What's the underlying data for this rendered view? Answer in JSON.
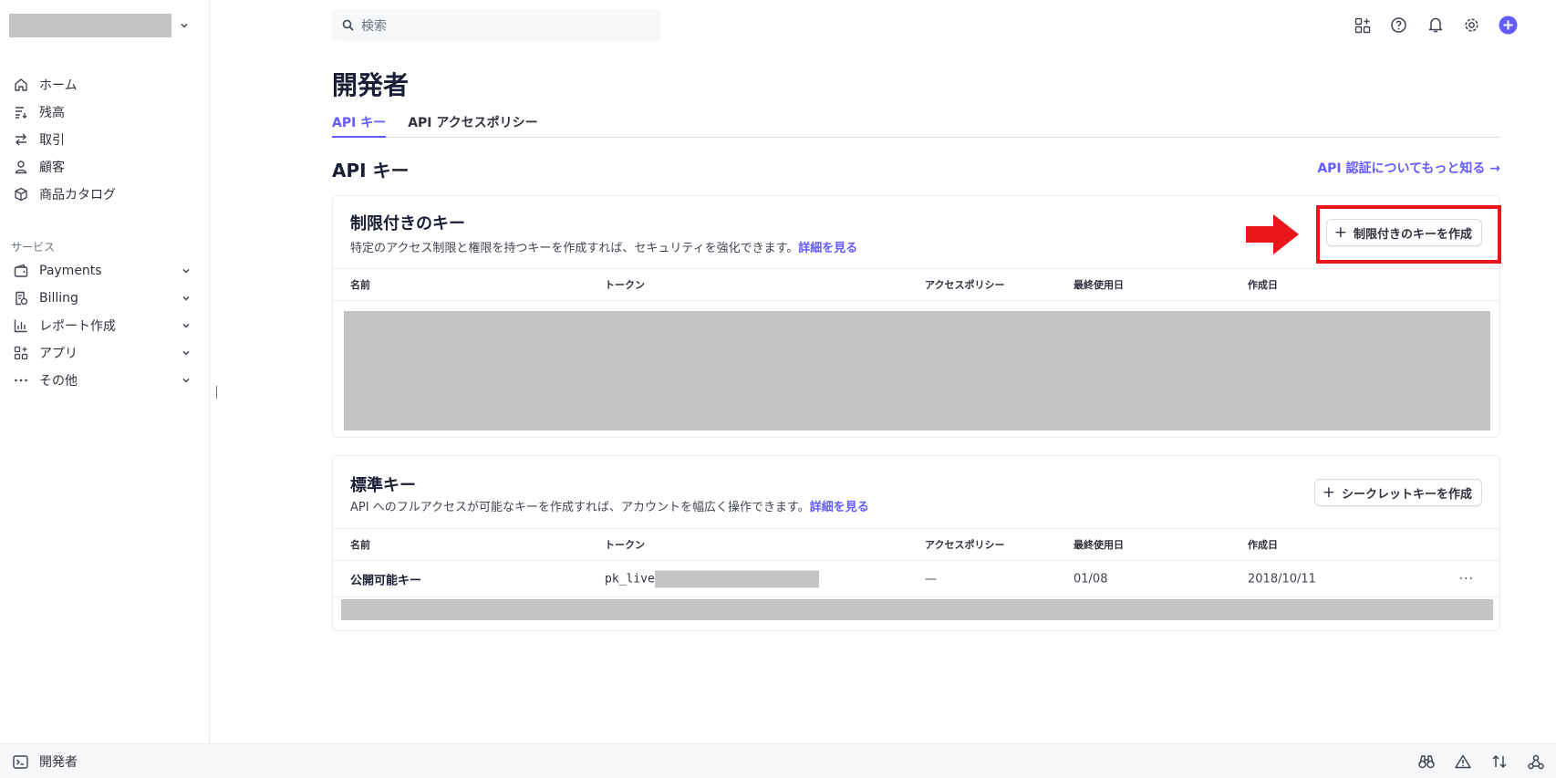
{
  "sidebar": {
    "nav": [
      {
        "label": "ホーム",
        "icon": "home-icon"
      },
      {
        "label": "残高",
        "icon": "balance-icon"
      },
      {
        "label": "取引",
        "icon": "transactions-icon"
      },
      {
        "label": "顧客",
        "icon": "person-icon"
      },
      {
        "label": "商品カタログ",
        "icon": "box-icon"
      }
    ],
    "section_label": "サービス",
    "services": [
      {
        "label": "Payments",
        "icon": "wallet-icon"
      },
      {
        "label": "Billing",
        "icon": "billing-icon"
      },
      {
        "label": "レポート作成",
        "icon": "bar-chart-icon"
      },
      {
        "label": "アプリ",
        "icon": "apps-icon"
      },
      {
        "label": "その他",
        "icon": "more-icon"
      }
    ]
  },
  "search": {
    "placeholder": "検索"
  },
  "page": {
    "title": "開発者"
  },
  "tabs": [
    {
      "label": "API キー",
      "active": true
    },
    {
      "label": "API アクセスポリシー",
      "active": false
    }
  ],
  "section": {
    "title": "API キー",
    "doc_link": "API 認証についてもっと知る →"
  },
  "restricted": {
    "title": "制限付きのキー",
    "description": "特定のアクセス制限と権限を持つキーを作成すれば、セキュリティを強化できます。",
    "learn_more": "詳細を見る",
    "create_button": "制限付きのキーを作成",
    "columns": [
      "名前",
      "トークン",
      "アクセスポリシー",
      "最終使用日",
      "作成日"
    ]
  },
  "standard": {
    "title": "標準キー",
    "description": "API へのフルアクセスが可能なキーを作成すれば、アカウントを幅広く操作できます。",
    "learn_more": "詳細を見る",
    "create_button": "シークレットキーを作成",
    "columns": [
      "名前",
      "トークン",
      "アクセスポリシー",
      "最終使用日",
      "作成日"
    ],
    "rows": [
      {
        "name": "公開可能キー",
        "token_prefix": "pk_live",
        "policy": "—",
        "last_used": "01/08",
        "created": "2018/10/11",
        "actions": "···"
      }
    ]
  },
  "bottom_bar": {
    "label": "開発者"
  },
  "colors": {
    "accent": "#635bff",
    "highlight": "#e8161b",
    "redaction": "#c4c4c4"
  }
}
